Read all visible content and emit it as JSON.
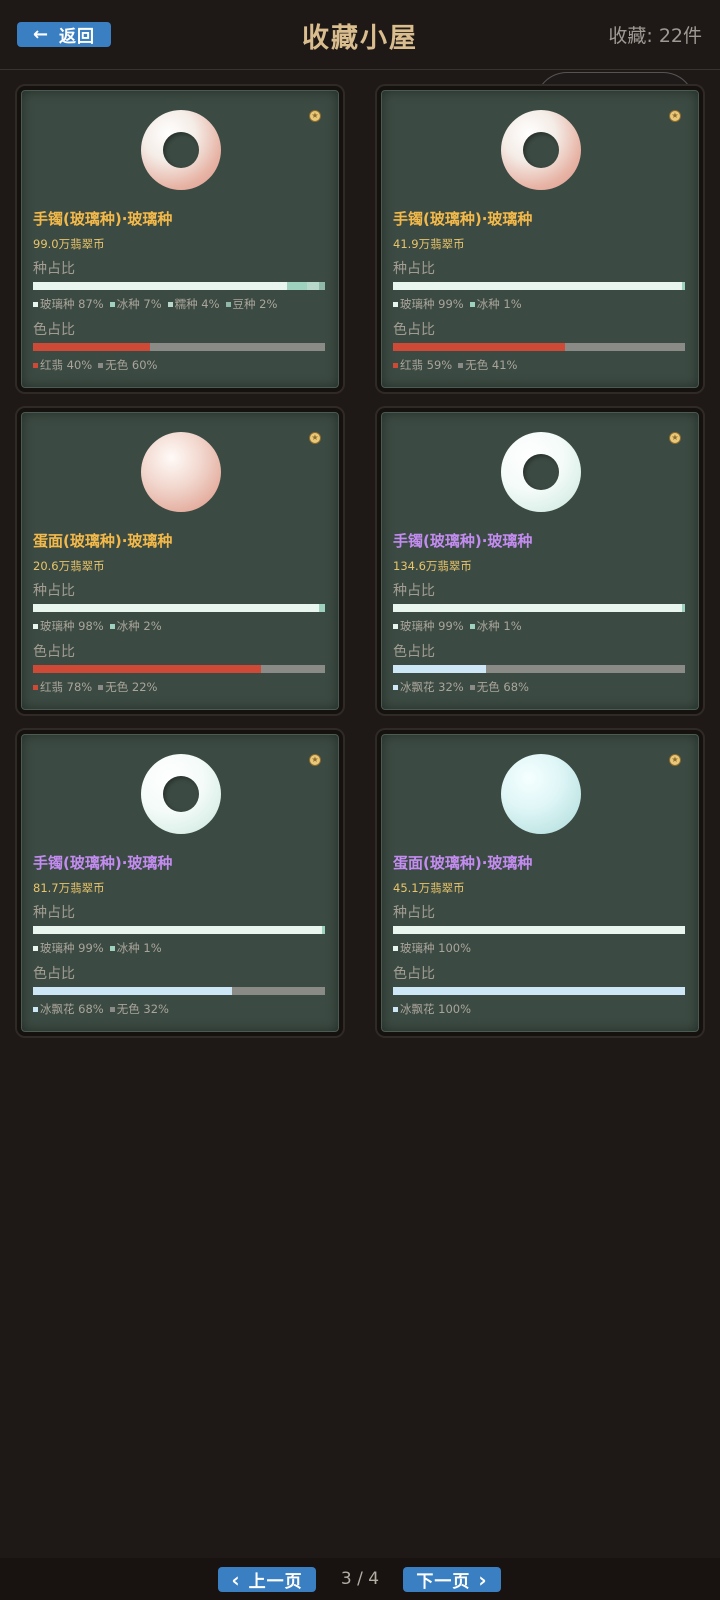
{
  "header": {
    "back_icon": "←",
    "back_label": "返回",
    "title": "收藏小屋",
    "count_label": "收藏: 22件"
  },
  "colors": {
    "glass": "#e9f6ef",
    "ice": "#c9ebe0",
    "glutinous": "#b9d6ca",
    "bean": "#9cc7b6",
    "red": "#cf4a36",
    "none": "#8a8a86",
    "ice_flower": "#cde7f6",
    "accent_blue": "#3a7fc2",
    "title_gold": "#d9bd8f",
    "name_gold": "#f3b94a",
    "name_purple": "#c38cf0"
  },
  "section_labels": {
    "kind": "种占比",
    "color": "色占比"
  },
  "items": [
    {
      "name": "手镯(玻璃种)·玻璃种",
      "name_color": "gold",
      "shape": "ring",
      "tint": "pink",
      "price": "99.0万翡翠币",
      "kind": [
        {
          "label": "玻璃种 87%",
          "value": 87,
          "color": "#e9f6ef"
        },
        {
          "label": "冰种 7%",
          "value": 7,
          "color": "#9fd1bf"
        },
        {
          "label": "糯种 4%",
          "value": 4,
          "color": "#b9d6ca"
        },
        {
          "label": "豆种 2%",
          "value": 2,
          "color": "#8fb8a8"
        }
      ],
      "color": [
        {
          "label": "红翡 40%",
          "value": 40,
          "color": "#cf4a36"
        },
        {
          "label": "无色 60%",
          "value": 60,
          "color": "#8a8a86"
        }
      ]
    },
    {
      "name": "手镯(玻璃种)·玻璃种",
      "name_color": "gold",
      "shape": "ring",
      "tint": "pink",
      "price": "41.9万翡翠币",
      "kind": [
        {
          "label": "玻璃种 99%",
          "value": 99,
          "color": "#e9f6ef"
        },
        {
          "label": "冰种 1%",
          "value": 1,
          "color": "#9fd1bf"
        }
      ],
      "color": [
        {
          "label": "红翡 59%",
          "value": 59,
          "color": "#cf4a36"
        },
        {
          "label": "无色 41%",
          "value": 41,
          "color": "#8a8a86"
        }
      ]
    },
    {
      "name": "蛋面(玻璃种)·玻璃种",
      "name_color": "gold",
      "shape": "dome",
      "tint": "pinkdome",
      "price": "20.6万翡翠币",
      "kind": [
        {
          "label": "玻璃种 98%",
          "value": 98,
          "color": "#e9f6ef"
        },
        {
          "label": "冰种 2%",
          "value": 2,
          "color": "#9fd1bf"
        }
      ],
      "color": [
        {
          "label": "红翡 78%",
          "value": 78,
          "color": "#cf4a36"
        },
        {
          "label": "无色 22%",
          "value": 22,
          "color": "#8a8a86"
        }
      ]
    },
    {
      "name": "手镯(玻璃种)·玻璃种",
      "name_color": "purple",
      "shape": "ring",
      "tint": "white",
      "price": "134.6万翡翠币",
      "kind": [
        {
          "label": "玻璃种 99%",
          "value": 99,
          "color": "#e9f6ef"
        },
        {
          "label": "冰种 1%",
          "value": 1,
          "color": "#9fd1bf"
        }
      ],
      "color": [
        {
          "label": "冰飘花 32%",
          "value": 32,
          "color": "#cde7f6"
        },
        {
          "label": "无色 68%",
          "value": 68,
          "color": "#8a8a86"
        }
      ]
    },
    {
      "name": "手镯(玻璃种)·玻璃种",
      "name_color": "purple",
      "shape": "ring",
      "tint": "white",
      "price": "81.7万翡翠币",
      "kind": [
        {
          "label": "玻璃种 99%",
          "value": 99,
          "color": "#e9f6ef"
        },
        {
          "label": "冰种 1%",
          "value": 1,
          "color": "#9fd1bf"
        }
      ],
      "color": [
        {
          "label": "冰飘花 68%",
          "value": 68,
          "color": "#cde7f6"
        },
        {
          "label": "无色 32%",
          "value": 32,
          "color": "#8a8a86"
        }
      ]
    },
    {
      "name": "蛋面(玻璃种)·玻璃种",
      "name_color": "purple",
      "shape": "dome",
      "tint": "ice",
      "price": "45.1万翡翠币",
      "kind": [
        {
          "label": "玻璃种 100%",
          "value": 100,
          "color": "#e9f6ef"
        }
      ],
      "color": [
        {
          "label": "冰飘花 100%",
          "value": 100,
          "color": "#cde7f6"
        }
      ]
    }
  ],
  "pagination": {
    "prev_label": "上一页",
    "next_label": "下一页",
    "prev_icon": "‹",
    "next_icon": "›",
    "page_info": "3 / 4"
  }
}
